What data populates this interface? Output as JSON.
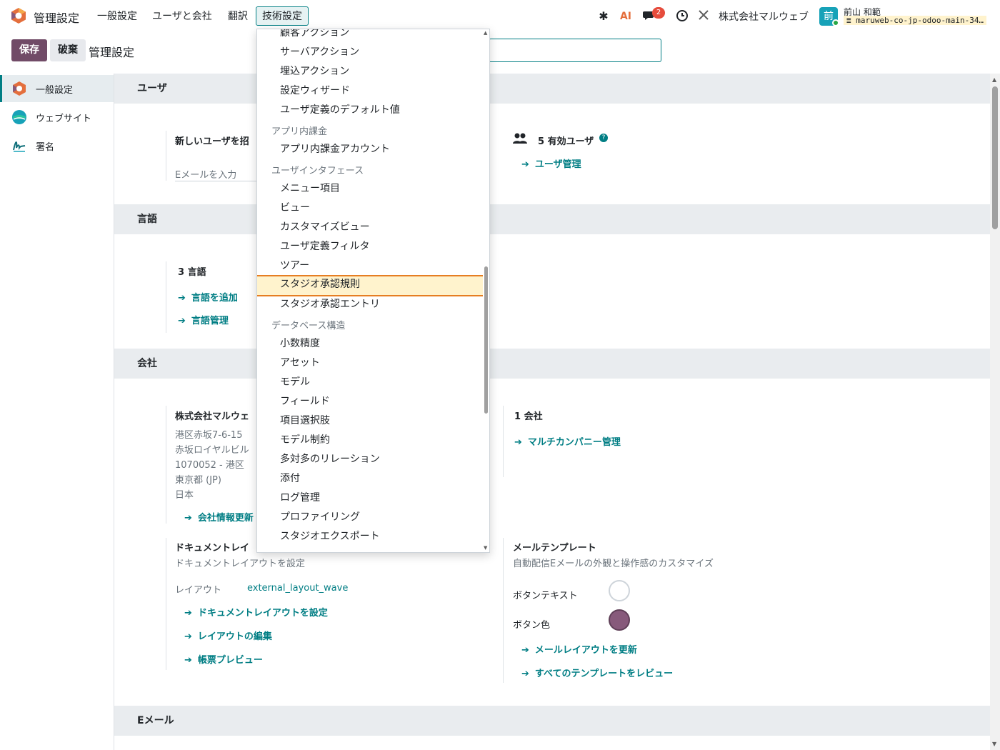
{
  "navbar": {
    "app_title": "管理設定",
    "menus": [
      "一般設定",
      "ユーザと会社",
      "翻訳",
      "技術設定"
    ],
    "message_count": "2",
    "company": "株式会社マルウェブ",
    "user": {
      "avatar_initial": "前",
      "name": "前山 和範",
      "database": "maruweb-co-jp-odoo-main-34…"
    }
  },
  "control_panel": {
    "save_label": "保存",
    "discard_label": "破棄",
    "breadcrumb": "管理設定"
  },
  "sidebar": {
    "items": [
      {
        "label": "一般設定",
        "icon": "odoo-settings-icon"
      },
      {
        "label": "ウェブサイト",
        "icon": "website-icon"
      },
      {
        "label": "署名",
        "icon": "signature-icon"
      }
    ]
  },
  "sections": {
    "users": {
      "title": "ユーザ",
      "invite_label": "新しいユーザを招",
      "email_placeholder": "Eメールを入力",
      "active_users": "5 有効ユーザ",
      "manage_users": "ユーザ管理"
    },
    "languages": {
      "title": "言語",
      "count": "3 言語",
      "add_language": "言語を追加",
      "manage_languages": "言語管理"
    },
    "companies": {
      "title": "会社",
      "company_name": "株式会社マルウェ",
      "address": [
        "港区赤坂7-6-15",
        "赤坂ロイヤルビル",
        "1070052 - 港区",
        "東京都 (JP)",
        "日本"
      ],
      "update_info": "会社情報更新",
      "company_count": "1 会社",
      "multi_company": "マルチカンパニー管理"
    },
    "document_layout": {
      "title": "ドキュメントレイ",
      "subtitle": "ドキュメントレイアウトを設定",
      "layout_label": "レイアウト",
      "layout_value": "external_layout_wave",
      "configure": "ドキュメントレイアウトを設定",
      "edit": "レイアウトの編集",
      "preview": "帳票プレビュー"
    },
    "mail_templates": {
      "title": "メールテンプレート",
      "subtitle": "自動配信Eメールの外観と操作感のカスタマイズ",
      "button_text_label": "ボタンテキスト",
      "button_color_label": "ボタン色",
      "button_text_color": "#ffffff",
      "button_color": "#875a7b",
      "update_layout": "メールレイアウトを更新",
      "review_all": "すべてのテンプレートをレビュー"
    },
    "email": {
      "title": "Eメール"
    }
  },
  "dropdown": {
    "rows": [
      {
        "type": "item",
        "label": "顧客アクション"
      },
      {
        "type": "item",
        "label": "サーバアクション"
      },
      {
        "type": "item",
        "label": "埋込アクション"
      },
      {
        "type": "item",
        "label": "設定ウィザード"
      },
      {
        "type": "item",
        "label": "ユーザ定義のデフォルト値"
      },
      {
        "type": "header",
        "label": "アプリ内課金"
      },
      {
        "type": "item",
        "label": "アプリ内課金アカウント"
      },
      {
        "type": "header",
        "label": "ユーザインタフェース"
      },
      {
        "type": "item",
        "label": "メニュー項目"
      },
      {
        "type": "item",
        "label": "ビュー"
      },
      {
        "type": "item",
        "label": "カスタマイズビュー"
      },
      {
        "type": "item",
        "label": "ユーザ定義フィルタ"
      },
      {
        "type": "item",
        "label": "ツアー"
      },
      {
        "type": "item",
        "label": "スタジオ承認規則",
        "selected": true
      },
      {
        "type": "item",
        "label": "スタジオ承認エントリ"
      },
      {
        "type": "header",
        "label": "データベース構造"
      },
      {
        "type": "item",
        "label": "小数精度"
      },
      {
        "type": "item",
        "label": "アセット"
      },
      {
        "type": "item",
        "label": "モデル"
      },
      {
        "type": "item",
        "label": "フィールド"
      },
      {
        "type": "item",
        "label": "項目選択肢"
      },
      {
        "type": "item",
        "label": "モデル制約"
      },
      {
        "type": "item",
        "label": "多対多のリレーション"
      },
      {
        "type": "item",
        "label": "添付"
      },
      {
        "type": "item",
        "label": "ログ管理"
      },
      {
        "type": "item",
        "label": "プロファイリング"
      },
      {
        "type": "item",
        "label": "スタジオエクスポート"
      }
    ]
  },
  "colors": {
    "accent": "#017e84",
    "brand": "#714b67",
    "highlight": "#fff3cd",
    "highlight_border": "#e67e22"
  }
}
